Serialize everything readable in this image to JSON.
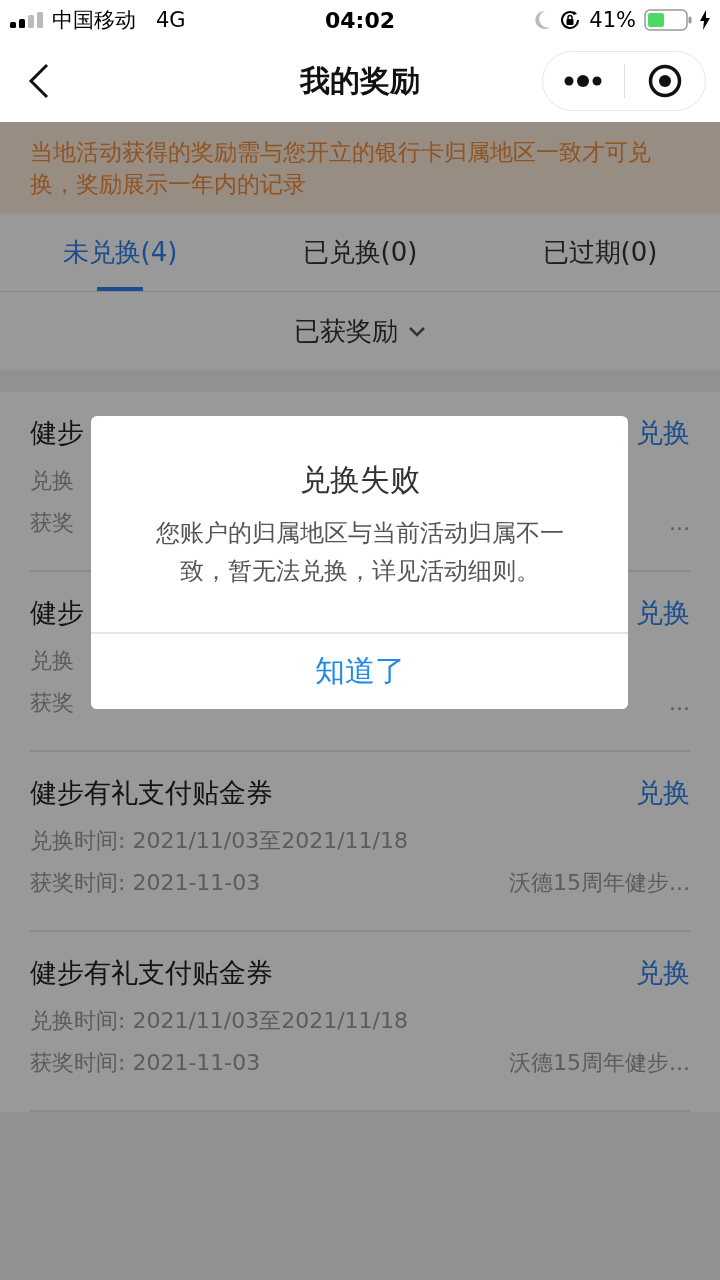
{
  "status_bar": {
    "carrier": "中国移动",
    "network": "4G",
    "time": "04:02",
    "battery": "41%"
  },
  "nav": {
    "title": "我的奖励"
  },
  "notice": "当地活动获得的奖励需与您开立的银行卡归属地区一致才可兑换，奖励展示一年内的记录",
  "tabs": [
    {
      "label": "未兑换(4)",
      "selected": true
    },
    {
      "label": "已兑换(0)",
      "selected": false
    },
    {
      "label": "已过期(0)",
      "selected": false
    }
  ],
  "filter": {
    "label": "已获奖励"
  },
  "rewards": [
    {
      "title": "健步",
      "redeem_period": "兑换",
      "award_date": "获奖",
      "activity": "...",
      "action": "兑换"
    },
    {
      "title": "健步",
      "redeem_period": "兑换",
      "award_date": "获奖",
      "activity": "...",
      "action": "兑换"
    },
    {
      "title": "健步有礼支付贴金券",
      "redeem_period": "兑换时间: 2021/11/03至2021/11/18",
      "award_date": "获奖时间: 2021-11-03",
      "activity": "沃德15周年健步...",
      "action": "兑换"
    },
    {
      "title": "健步有礼支付贴金券",
      "redeem_period": "兑换时间: 2021/11/03至2021/11/18",
      "award_date": "获奖时间: 2021-11-03",
      "activity": "沃德15周年健步...",
      "action": "兑换"
    }
  ],
  "dialog": {
    "title": "兑换失败",
    "message": "您账户的归属地区与当前活动归属不一致，暂无法兑换，详见活动细则。",
    "button": "知道了"
  }
}
